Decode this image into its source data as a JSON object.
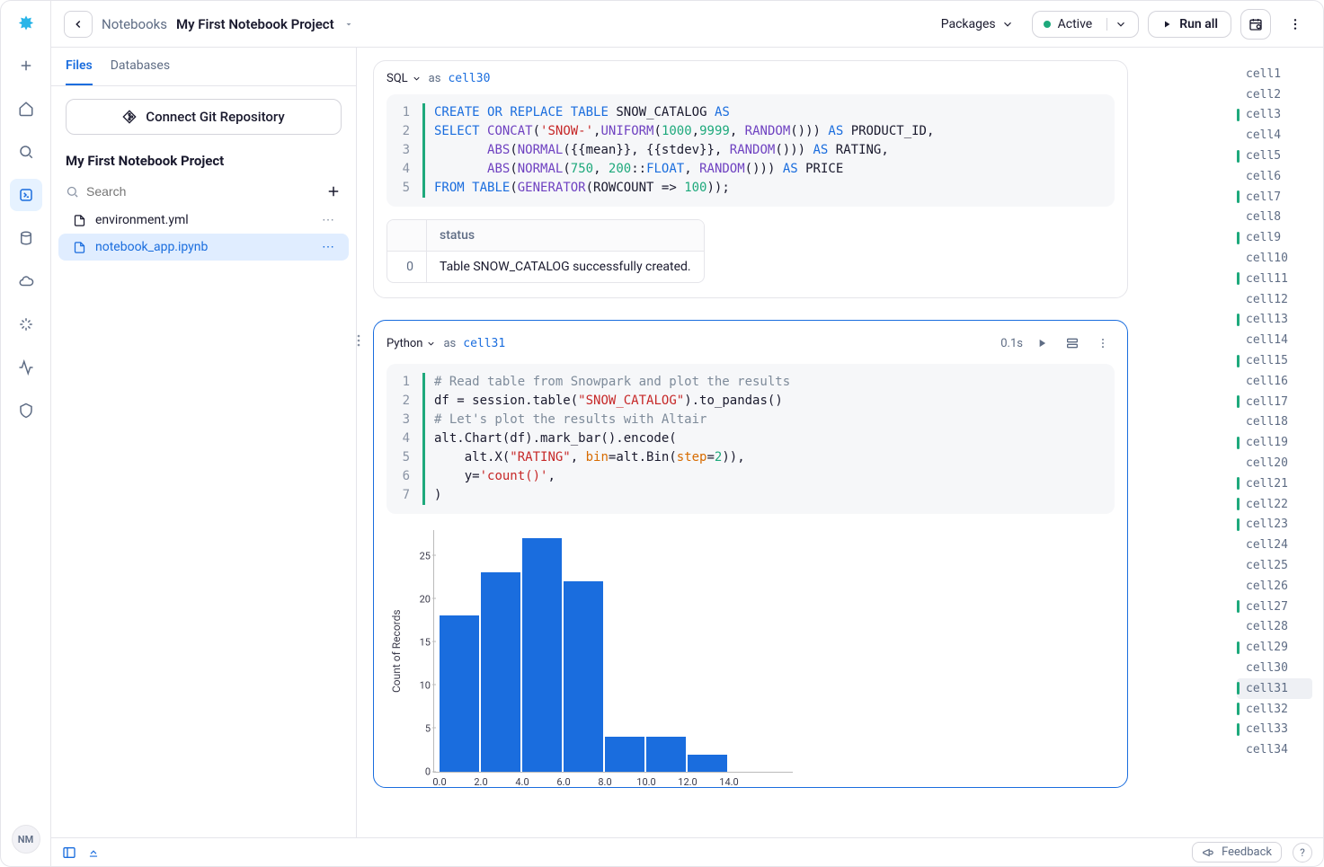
{
  "header": {
    "breadcrumb_root": "Notebooks",
    "breadcrumb_current": "My First Notebook Project",
    "packages_label": "Packages",
    "status_label": "Active",
    "run_all_label": "Run all"
  },
  "sidebar": {
    "tabs": {
      "files": "Files",
      "databases": "Databases"
    },
    "git_button": "Connect Git Repository",
    "project_title": "My First Notebook Project",
    "search_placeholder": "Search",
    "files": [
      {
        "name": "environment.yml",
        "active": false
      },
      {
        "name": "notebook_app.ipynb",
        "active": true
      }
    ]
  },
  "avatar": "NM",
  "cells": {
    "cell30": {
      "lang": "SQL",
      "as": "as",
      "name": "cell30",
      "code_lines": [
        [
          {
            "t": "CREATE",
            "c": "kw"
          },
          {
            "t": " "
          },
          {
            "t": "OR",
            "c": "kw"
          },
          {
            "t": " "
          },
          {
            "t": "REPLACE",
            "c": "kw"
          },
          {
            "t": " "
          },
          {
            "t": "TABLE",
            "c": "kw"
          },
          {
            "t": " SNOW_CATALOG ",
            "c": "id"
          },
          {
            "t": "AS",
            "c": "kw"
          }
        ],
        [
          {
            "t": "SELECT",
            "c": "kw"
          },
          {
            "t": " "
          },
          {
            "t": "CONCAT",
            "c": "fn"
          },
          {
            "t": "(",
            "c": "op"
          },
          {
            "t": "'SNOW-'",
            "c": "str"
          },
          {
            "t": ",",
            "c": "op"
          },
          {
            "t": "UNIFORM",
            "c": "fn"
          },
          {
            "t": "(",
            "c": "op"
          },
          {
            "t": "1000",
            "c": "num"
          },
          {
            "t": ",",
            "c": "op"
          },
          {
            "t": "9999",
            "c": "num"
          },
          {
            "t": ", ",
            "c": "op"
          },
          {
            "t": "RANDOM",
            "c": "fn"
          },
          {
            "t": "())) ",
            "c": "op"
          },
          {
            "t": "AS",
            "c": "kw"
          },
          {
            "t": " PRODUCT_ID,",
            "c": "id"
          }
        ],
        [
          {
            "t": "       "
          },
          {
            "t": "ABS",
            "c": "fn"
          },
          {
            "t": "(",
            "c": "op"
          },
          {
            "t": "NORMAL",
            "c": "fn"
          },
          {
            "t": "({{mean}}, {{stdev}}, ",
            "c": "op"
          },
          {
            "t": "RANDOM",
            "c": "fn"
          },
          {
            "t": "())) ",
            "c": "op"
          },
          {
            "t": "AS",
            "c": "kw"
          },
          {
            "t": " RATING,",
            "c": "id"
          }
        ],
        [
          {
            "t": "       "
          },
          {
            "t": "ABS",
            "c": "fn"
          },
          {
            "t": "(",
            "c": "op"
          },
          {
            "t": "NORMAL",
            "c": "fn"
          },
          {
            "t": "(",
            "c": "op"
          },
          {
            "t": "750",
            "c": "num"
          },
          {
            "t": ", ",
            "c": "op"
          },
          {
            "t": "200",
            "c": "num"
          },
          {
            "t": "::",
            "c": "op"
          },
          {
            "t": "FLOAT",
            "c": "kw"
          },
          {
            "t": ", ",
            "c": "op"
          },
          {
            "t": "RANDOM",
            "c": "fn"
          },
          {
            "t": "())) ",
            "c": "op"
          },
          {
            "t": "AS",
            "c": "kw"
          },
          {
            "t": " PRICE",
            "c": "id"
          }
        ],
        [
          {
            "t": "FROM",
            "c": "kw"
          },
          {
            "t": " "
          },
          {
            "t": "TABLE",
            "c": "kw"
          },
          {
            "t": "(",
            "c": "op"
          },
          {
            "t": "GENERATOR",
            "c": "fn"
          },
          {
            "t": "(ROWCOUNT => ",
            "c": "op"
          },
          {
            "t": "100",
            "c": "num"
          },
          {
            "t": "));",
            "c": "op"
          }
        ]
      ],
      "result": {
        "header": [
          "",
          "status"
        ],
        "rows": [
          [
            "0",
            "Table SNOW_CATALOG successfully created."
          ]
        ]
      }
    },
    "cell31": {
      "lang": "Python",
      "as": "as",
      "name": "cell31",
      "time": "0.1s",
      "code_lines": [
        [
          {
            "t": "# Read table from Snowpark and plot the results",
            "c": "cmt"
          }
        ],
        [
          {
            "t": "df ",
            "c": "id"
          },
          {
            "t": "=",
            "c": "op"
          },
          {
            "t": " session.table(",
            "c": "id"
          },
          {
            "t": "\"SNOW_CATALOG\"",
            "c": "str"
          },
          {
            "t": ").to_pandas()",
            "c": "id"
          }
        ],
        [
          {
            "t": "# Let's plot the results with Altair",
            "c": "cmt"
          }
        ],
        [
          {
            "t": "alt.Chart(df).mark_bar().encode(",
            "c": "id"
          }
        ],
        [
          {
            "t": "    alt.X(",
            "c": "id"
          },
          {
            "t": "\"RATING\"",
            "c": "str"
          },
          {
            "t": ", ",
            "c": "op"
          },
          {
            "t": "bin",
            "c": "dec"
          },
          {
            "t": "=",
            "c": "op"
          },
          {
            "t": "alt.Bin(",
            "c": "id"
          },
          {
            "t": "step",
            "c": "dec"
          },
          {
            "t": "=",
            "c": "op"
          },
          {
            "t": "2",
            "c": "num"
          },
          {
            "t": ")),",
            "c": "id"
          }
        ],
        [
          {
            "t": "    y",
            "c": "id"
          },
          {
            "t": "=",
            "c": "op"
          },
          {
            "t": "'count()'",
            "c": "str"
          },
          {
            "t": ",",
            "c": "op"
          }
        ],
        [
          {
            "t": ")",
            "c": "id"
          }
        ]
      ]
    }
  },
  "chart_data": {
    "type": "bar",
    "categories": [
      0.0,
      2.0,
      4.0,
      6.0,
      8.0,
      10.0,
      12.0,
      14.0
    ],
    "values": [
      18,
      23,
      27,
      22,
      4,
      4,
      2
    ],
    "ylabel": "Count of Records",
    "yticks": [
      0,
      5,
      10,
      15,
      20,
      25
    ],
    "ylim": [
      0,
      28
    ]
  },
  "cell_index": {
    "green": [
      3,
      5,
      7,
      9,
      11,
      13,
      15,
      17,
      19,
      21,
      22,
      23,
      27,
      29,
      31,
      32,
      33
    ],
    "selected": 31,
    "count": 34,
    "prefix": "cell"
  },
  "bottom": {
    "feedback": "Feedback"
  }
}
